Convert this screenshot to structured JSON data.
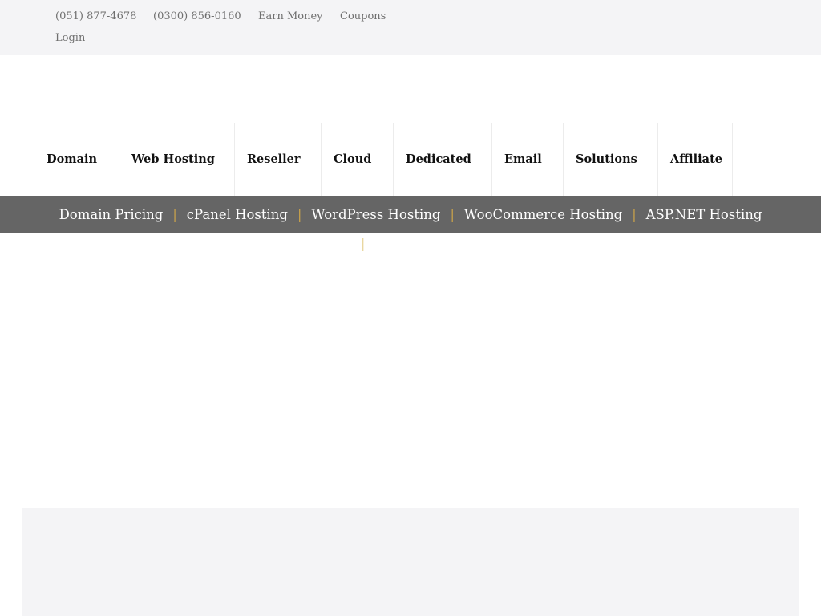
{
  "topbar": {
    "phone1": "(051) 877-4678",
    "phone2": "(0300) 856-0160",
    "earn_money": "Earn Money",
    "coupons": "Coupons",
    "login": "Login"
  },
  "main_nav": {
    "items": [
      {
        "label": "Domain"
      },
      {
        "label": "Web Hosting"
      },
      {
        "label": "Reseller"
      },
      {
        "label": "Cloud"
      },
      {
        "label": "Dedicated"
      },
      {
        "label": "Email"
      },
      {
        "label": "Solutions"
      },
      {
        "label": "Affiliate"
      }
    ]
  },
  "sub_nav": {
    "separator": "|",
    "items": [
      {
        "label": "Domain Pricing"
      },
      {
        "label": "cPanel Hosting"
      },
      {
        "label": "WordPress Hosting"
      },
      {
        "label": "WooCommerce Hosting"
      },
      {
        "label": "ASP.NET Hosting"
      }
    ]
  },
  "colors": {
    "topbar_bg": "#f4f4f6",
    "subnav_bg": "#656565",
    "separator": "#c9a24a"
  }
}
